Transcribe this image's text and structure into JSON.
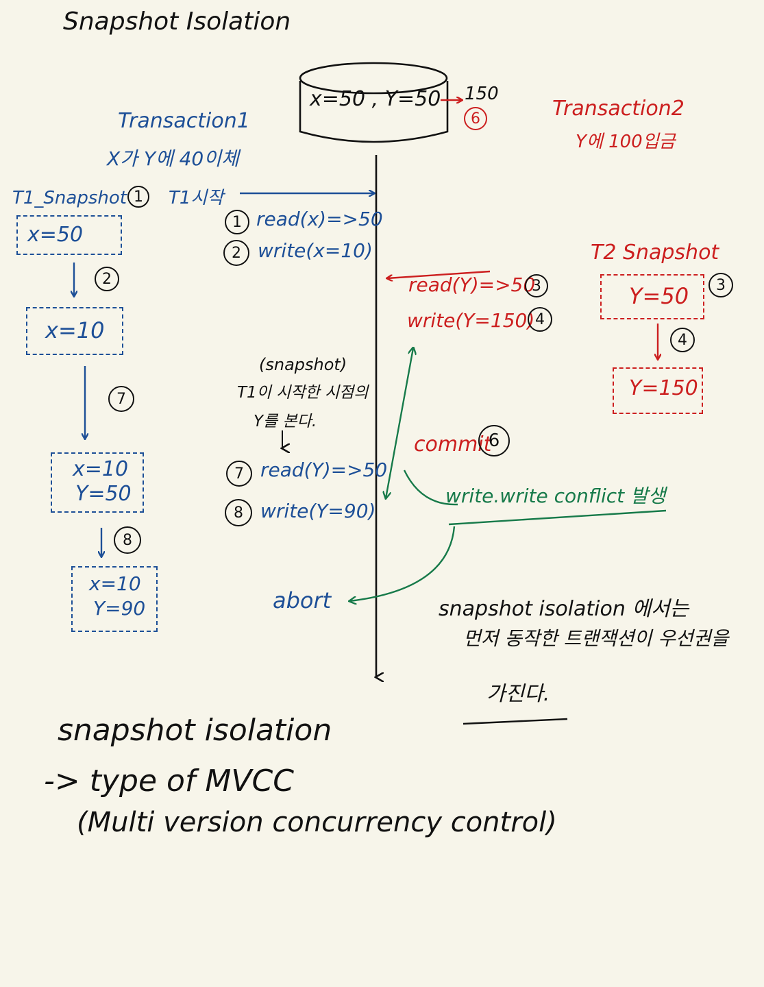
{
  "title": "Snapshot Isolation",
  "db": {
    "values": "x=50 , Y=50",
    "update": "150",
    "update_step": "6"
  },
  "t1": {
    "title": "Transaction1",
    "desc": "X가 Y에 40이체",
    "snapshot_label": "T1_Snapshot",
    "snapshot_step": "1",
    "start_label": "T1시작",
    "box1": [
      "x=50"
    ],
    "step2": "2",
    "box2": [
      "x=10"
    ],
    "step7": "7",
    "box3": [
      "x=10",
      "Y=50"
    ],
    "step8": "8",
    "box4": [
      "x=10",
      "Y=90"
    ]
  },
  "t1_ops": {
    "op1": {
      "step": "1",
      "text": "read(x)=>50"
    },
    "op2": {
      "step": "2",
      "text": "write(x=10)"
    },
    "op7": {
      "step": "7",
      "text": "read(Y)=>50"
    },
    "op8": {
      "step": "8",
      "text": "write(Y=90)"
    },
    "abort": "abort"
  },
  "note": {
    "line1": "(snapshot)",
    "line2": "T1이 시작한 시점의",
    "line3": "Y를 본다."
  },
  "t2": {
    "title": "Transaction2",
    "desc": "Y에 100입금",
    "op3": {
      "step": "3",
      "text": "read(Y)=>50"
    },
    "op4": {
      "step": "4",
      "text": "write(Y=150)"
    },
    "commit": {
      "text": "commit",
      "step": "6"
    },
    "snapshot_label": "T2 Snapshot",
    "box1": [
      "Y=50"
    ],
    "step3": "3",
    "step4": "4",
    "box2": [
      "Y=150"
    ]
  },
  "conflict": "write.write conflict 발생",
  "summary": {
    "line1": "snapshot isolation 에서는",
    "line2": "먼저 동작한 트랜잭션이 우선권을",
    "line3": "가진다."
  },
  "footer": {
    "line1": "snapshot isolation",
    "line2": "-> type of MVCC",
    "line3": "(Multi version concurrency control)"
  },
  "colors": {
    "blue": "#1d4f97",
    "red": "#cc1f1f",
    "green": "#177a4a",
    "ink": "#111111",
    "paper": "#f7f5ea"
  }
}
